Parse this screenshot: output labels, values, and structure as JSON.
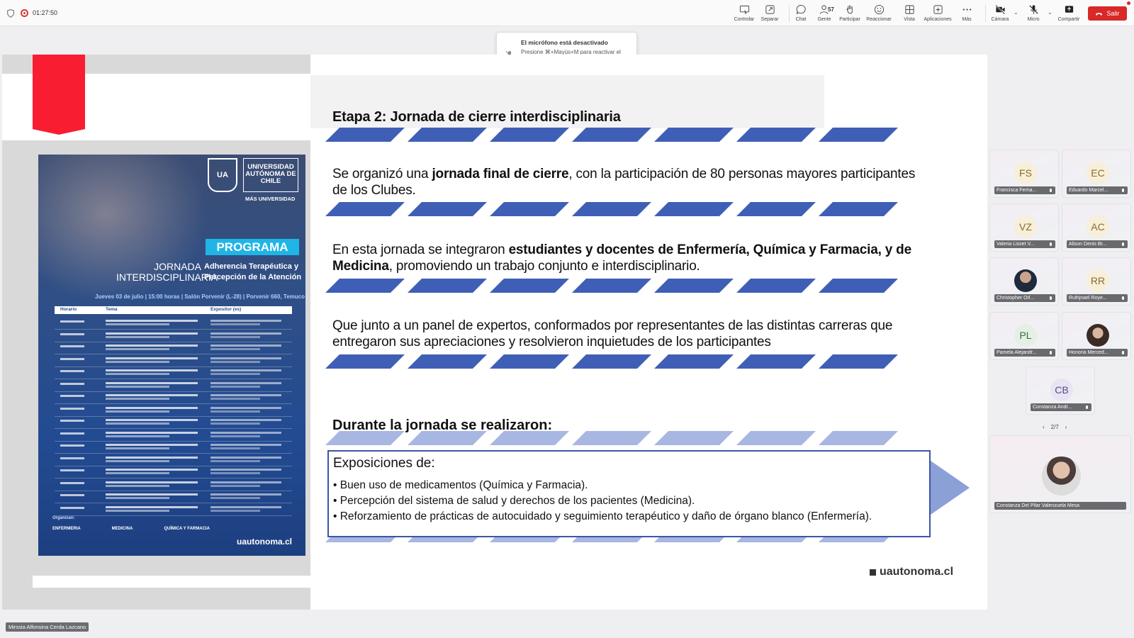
{
  "meeting": {
    "timer": "01:27:50"
  },
  "toolbar": {
    "buttons": [
      {
        "label": "Controlar",
        "icon": "control-icon"
      },
      {
        "label": "Separar",
        "icon": "popout-icon"
      },
      {
        "label": "Chat",
        "icon": "chat-icon"
      },
      {
        "label": "Gente",
        "icon": "people-icon",
        "count": "57"
      },
      {
        "label": "Participar",
        "icon": "raise-hand-icon"
      },
      {
        "label": "Reaccionar",
        "icon": "react-icon"
      },
      {
        "label": "Vista",
        "icon": "view-icon"
      },
      {
        "label": "Aplicaciones",
        "icon": "apps-icon"
      },
      {
        "label": "Más",
        "icon": "more-icon"
      },
      {
        "label": "Cámara",
        "icon": "camera-off-icon"
      },
      {
        "label": "Micro",
        "icon": "mic-off-icon"
      },
      {
        "label": "Compartir",
        "icon": "share-icon"
      }
    ],
    "leave_label": "Salir",
    "leave_color": "#d82828"
  },
  "toast": {
    "title": "El micrófono está desactivado",
    "body": "Presione ⌘+Mayús+M para reactivar el audio o mantenga presionado Opción+barra espaciadora."
  },
  "slide": {
    "heading": "Etapa 2: Jornada de cierre interdisciplinaria",
    "p1": {
      "a": "Se organizó una ",
      "b": "jornada final de cierre",
      "c": ", con la participación de 80 personas mayores participantes de los Clubes."
    },
    "p2": {
      "a": "En esta jornada se integraron ",
      "b": "estudiantes y docentes de Enfermería, Química y Farmacia, y de Medicina",
      "c": ", promoviendo un trabajo conjunto e interdisciplinario."
    },
    "p3": "Que junto a un panel de expertos, conformados por representantes de las distintas carreras que entregaron sus apreciaciones y resolvieron inquietudes de los participantes",
    "subheading": "Durante la jornada se realizaron:",
    "box_title": "Exposiciones de:",
    "box_items": [
      "Buen uso de medicamentos (Química y Farmacia).",
      "Percepción del sistema de salud y derechos de los pacientes (Medicina).",
      "Reforzamiento de prácticas de autocuidado y seguimiento terapéutico y daño de órgano blanco (Enfermería)."
    ],
    "footer_url": "uautonoma.cl",
    "accent": "#f91d32",
    "stripe_color": "#3f5fb6"
  },
  "poster": {
    "shield": "UA",
    "university": "UNIVERSIDAD AUTÓNOMA DE CHILE",
    "tagline": "MÁS UNIVERSIDAD",
    "programa": "PROGRAMA",
    "jornada": "JORNADA INTERDISCIPLINARIA",
    "topic": "Adherencia Terapéutica y Percepción de la Atención",
    "date": "Jueves 03 de julio | 15:00 horas | Salón Porvenir (L-28) | Porvenir 660, Temuco",
    "col_horario": "Horario",
    "col_tema": "Tema",
    "col_expositor": "Expositor (es)",
    "organizan": "Organizan:",
    "orgs": [
      "ENFERMERIA",
      "MEDICINA",
      "QUÍMICA Y FARMACIA"
    ],
    "url": "uautonoma.cl"
  },
  "participants": [
    {
      "initials": "FS",
      "name": "Francisca Ferna..."
    },
    {
      "initials": "EC",
      "name": "Eduardo Marcel..."
    },
    {
      "initials": "VZ",
      "name": "Valeria Lisset V..."
    },
    {
      "initials": "AC",
      "name": "Alison Denis Br..."
    },
    {
      "initials": "",
      "name": "Christopher Orl..."
    },
    {
      "initials": "RR",
      "name": "Ruthjnael Roye..."
    },
    {
      "initials": "PL",
      "name": "Pamela Alejandr..."
    },
    {
      "initials": "",
      "name": "Honoria Merced..."
    },
    {
      "initials": "CB",
      "name": "Constanza Andr..."
    }
  ],
  "pager": {
    "label": "2/7"
  },
  "self_view": {
    "name": "Constanza Del Pilar Valenzuela Mesa"
  },
  "presenter": {
    "name": "Mirssia Alfonsina Cerda Lazcano"
  }
}
